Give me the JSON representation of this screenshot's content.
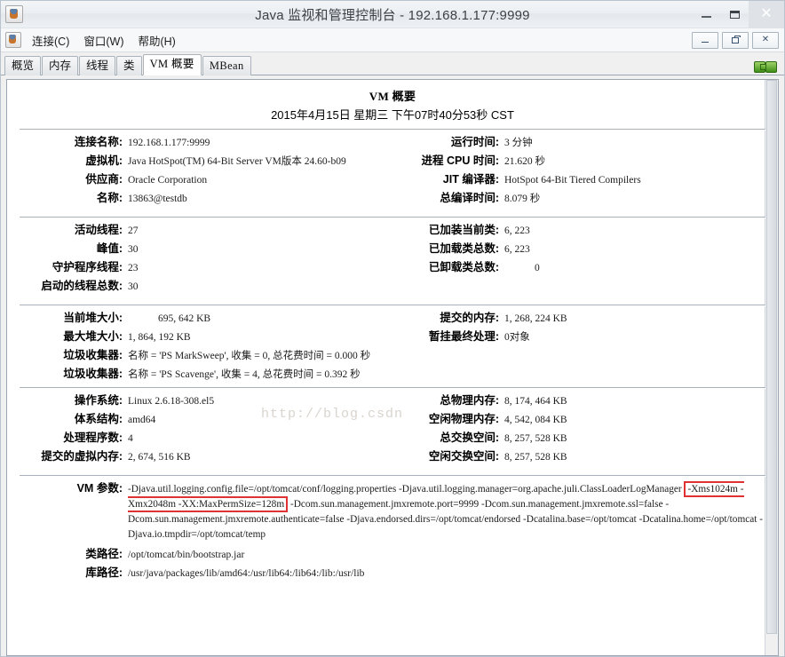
{
  "window": {
    "title": "Java 监视和管理控制台 - 192.168.1.177:9999",
    "app_icon": "java-coffee-cup-icon",
    "minimize_label": "最小化",
    "maximize_label": "最大化",
    "close_label": "关闭"
  },
  "menubar": {
    "icon": "java-coffee-cup-icon",
    "items": [
      {
        "label": "连接(C)"
      },
      {
        "label": "窗口(W)"
      },
      {
        "label": "帮助(H)"
      }
    ],
    "mdi_buttons": [
      {
        "name": "mdi-minimize",
        "label": "_"
      },
      {
        "name": "mdi-restore",
        "label": "❐"
      },
      {
        "name": "mdi-close",
        "label": "x"
      }
    ]
  },
  "tabs": [
    {
      "label": "概览",
      "active": false
    },
    {
      "label": "内存",
      "active": false
    },
    {
      "label": "线程",
      "active": false
    },
    {
      "label": "类",
      "active": false
    },
    {
      "label": "VM 概要",
      "active": true
    },
    {
      "label": "MBean",
      "active": false
    }
  ],
  "connection_indicator": "connected-plug-icon",
  "page": {
    "title": "VM 概要",
    "timestamp": "2015年4月15日 星期三 下午07时40分53秒 CST",
    "watermark": "http://blog.csdn"
  },
  "summary": {
    "left": [
      {
        "label": "连接名称",
        "value": "192.168.1.177:9999"
      },
      {
        "label": "虚拟机",
        "value": "Java HotSpot(TM) 64-Bit Server VM版本 24.60-b09"
      },
      {
        "label": "供应商",
        "value": "Oracle Corporation"
      },
      {
        "label": "名称",
        "value": "13863@testdb"
      }
    ],
    "right": [
      {
        "label": "运行时间",
        "value": "3 分钟"
      },
      {
        "label": "进程 CPU 时间",
        "value": "21.620 秒"
      },
      {
        "label": "JIT 编译器",
        "value": "HotSpot 64-Bit Tiered Compilers"
      },
      {
        "label": "总编译时间",
        "value": "8.079 秒"
      }
    ]
  },
  "threads": {
    "left": [
      {
        "label": "活动线程",
        "value": "27"
      },
      {
        "label": "峰值",
        "value": "30"
      },
      {
        "label": "守护程序线程",
        "value": "23"
      },
      {
        "label": "启动的线程总数",
        "value": "30"
      }
    ],
    "right": [
      {
        "label": "已加装当前类",
        "value": "6, 223",
        "indent": false
      },
      {
        "label": "已加载类总数",
        "value": "6, 223",
        "indent": false
      },
      {
        "label": "已卸载类总数",
        "value": "0",
        "indent": true
      }
    ]
  },
  "memory": {
    "left": [
      {
        "label": "当前堆大小",
        "value": "695, 642 KB",
        "indent": true
      },
      {
        "label": "最大堆大小",
        "value": "1, 864, 192 KB",
        "indent": false
      }
    ],
    "right": [
      {
        "label": "提交的内存",
        "value": "1, 268, 224 KB"
      },
      {
        "label": "暂挂最终处理",
        "value": "0对象"
      }
    ],
    "gc": [
      {
        "label": "垃圾收集器",
        "value": "名称 = 'PS MarkSweep', 收集 = 0, 总花费时间 = 0.000 秒"
      },
      {
        "label": "垃圾收集器",
        "value": "名称 = 'PS Scavenge', 收集 = 4, 总花费时间 = 0.392 秒"
      }
    ]
  },
  "os": {
    "left": [
      {
        "label": "操作系统",
        "value": "Linux 2.6.18-308.el5"
      },
      {
        "label": "体系结构",
        "value": "amd64"
      },
      {
        "label": "处理程序数",
        "value": "4"
      },
      {
        "label": "提交的虚拟内存",
        "value": "2, 674, 516 KB"
      }
    ],
    "right": [
      {
        "label": "总物理内存",
        "value": "8, 174, 464 KB"
      },
      {
        "label": "空闲物理内存",
        "value": "4, 542, 084 KB"
      },
      {
        "label": "总交换空间",
        "value": "8, 257, 528 KB"
      },
      {
        "label": "空闲交换空间",
        "value": "8, 257, 528 KB"
      }
    ]
  },
  "vm_args": {
    "label": "VM 参数",
    "seg1": "-Djava.util.logging.config.file=/opt/tomcat/conf/logging.properties -Djava.util.logging.manager=org.apache.juli.ClassLoaderLogManager ",
    "highlight1": "-Xms1024m -",
    "highlight2": "Xmx2048m -XX:MaxPermSize=128m",
    "seg2": " -Dcom.sun.management.jmxremote.port=9999 -Dcom.sun.management.jmxremote.ssl=false -Dcom.sun.management.jmxremote.authenticate=false -Djava.endorsed.dirs=/opt/tomcat/endorsed -Dcatalina.base=/opt/tomcat -Dcatalina.home=/opt/tomcat -Djava.io.tmpdir=/opt/tomcat/temp",
    "highlight_color": "#e03232"
  },
  "paths": [
    {
      "label": "类路径",
      "value": "/opt/tomcat/bin/bootstrap.jar"
    },
    {
      "label": "库路径",
      "value": "/usr/java/packages/lib/amd64:/usr/lib64:/lib64:/lib:/usr/lib"
    }
  ]
}
